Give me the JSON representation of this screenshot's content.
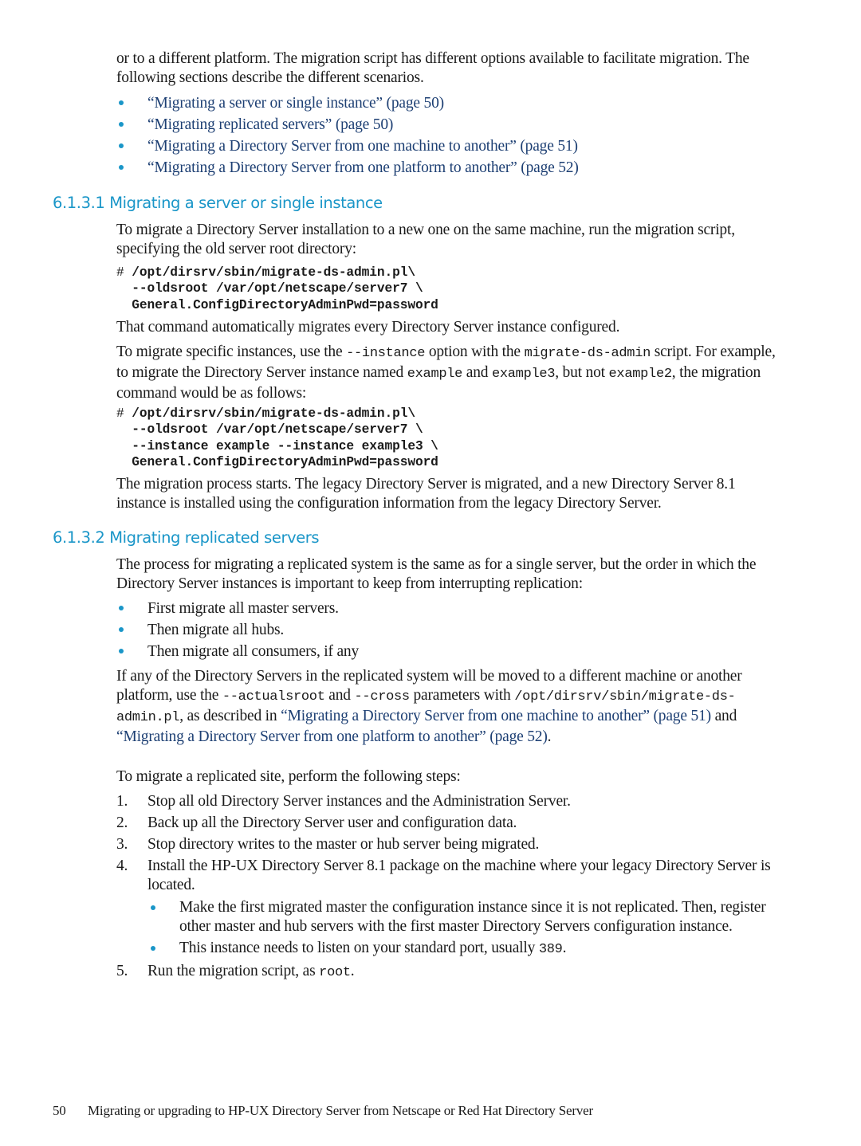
{
  "intro": {
    "line": "or to a different platform. The migration script has different options available to facilitate migration. The following sections describe the different scenarios."
  },
  "toc_links": [
    {
      "label": "“Migrating a server or single instance” (page 50)"
    },
    {
      "label": "“Migrating replicated servers” (page 50)"
    },
    {
      "label": "“Migrating a Directory Server from one machine to another” (page 51)"
    },
    {
      "label": "“Migrating a Directory Server from one platform to another” (page 52)"
    }
  ],
  "section1": {
    "heading": "6.1.3.1 Migrating a server or single instance",
    "para1": "To migrate a Directory Server installation to a new one on the same machine, run the migration script, specifying the old server root directory:",
    "code1": {
      "prompt": "# ",
      "lines": [
        "/opt/dirsrv/sbin/migrate-ds-admin.pl\\",
        "  --oldsroot /var/opt/netscape/server7 \\",
        "  General.ConfigDirectoryAdminPwd=password"
      ]
    },
    "para2": "That command automatically migrates every Directory Server instance configured.",
    "para3": {
      "t1": "To migrate specific instances, use the ",
      "c1": "--instance",
      "t2": " option with the ",
      "c2": "migrate-ds-admin",
      "t3": " script. For example, to migrate the Directory Server instance named ",
      "c3": "example",
      "t4": " and ",
      "c4": "example3",
      "t5": ", but not ",
      "c5": "example2",
      "t6": ", the migration command would be as follows:"
    },
    "code2": {
      "prompt": "# ",
      "lines": [
        "/opt/dirsrv/sbin/migrate-ds-admin.pl\\",
        "  --oldsroot /var/opt/netscape/server7 \\",
        "  --instance example --instance example3 \\",
        "  General.ConfigDirectoryAdminPwd=password"
      ]
    },
    "para4": "The migration process starts. The legacy Directory Server is migrated, and a new Directory Server 8.1 instance is installed using the configuration information from the legacy Directory Server."
  },
  "section2": {
    "heading": "6.1.3.2 Migrating replicated servers",
    "para1": "The process for migrating a replicated system is the same as for a single server, but the order in which the Directory Server instances is important to keep from interrupting replication:",
    "bullets": [
      {
        "label": "First migrate all master servers."
      },
      {
        "label": "Then migrate all hubs."
      },
      {
        "label": "Then migrate all consumers, if any"
      }
    ],
    "para2": {
      "t1": "If any of the Directory Servers in the replicated system will be moved to a different machine or another platform, use the ",
      "c1": "--actualsroot",
      "t2": " and ",
      "c2": "--cross",
      "t3": " parameters with ",
      "c3": "/opt/dirsrv/sbin/migrate-ds-admin.pl",
      "t4": ", as described in ",
      "link1": "“Migrating a Directory Server from one machine to another” (page 51)",
      "t5": " and ",
      "link2": "“Migrating a Directory Server from one platform to another” (page 52)",
      "t6": "."
    },
    "para3": "To migrate a replicated site, perform the following steps:",
    "steps": [
      {
        "num": "1.",
        "label": "Stop all old Directory Server instances and the Administration Server."
      },
      {
        "num": "2.",
        "label": "Back up all the Directory Server user and configuration data."
      },
      {
        "num": "3.",
        "label": "Stop directory writes to the master or hub server being migrated."
      },
      {
        "num": "4.",
        "label": "Install the HP-UX Directory Server 8.1 package on the machine where your legacy Directory Server is located."
      },
      {
        "num": "5.",
        "label_pre": "Run the migration script, as ",
        "code": "root",
        "label_post": "."
      }
    ],
    "step4_sub": [
      {
        "label": "Make the first migrated master the configuration instance since it is not replicated. Then, register other master and hub servers with the first master Directory Servers configuration instance."
      },
      {
        "label_pre": "This instance needs to listen on your standard port, usually ",
        "code": "389",
        "label_post": "."
      }
    ]
  },
  "footer": {
    "page_number": "50",
    "title": "Migrating or upgrading to HP-UX Directory Server from Netscape or Red Hat Directory Server"
  },
  "colors": {
    "heading": "#1a96c8",
    "link": "#1d3f73",
    "bullet": "#1a96c8",
    "text": "#1a1a1a"
  }
}
